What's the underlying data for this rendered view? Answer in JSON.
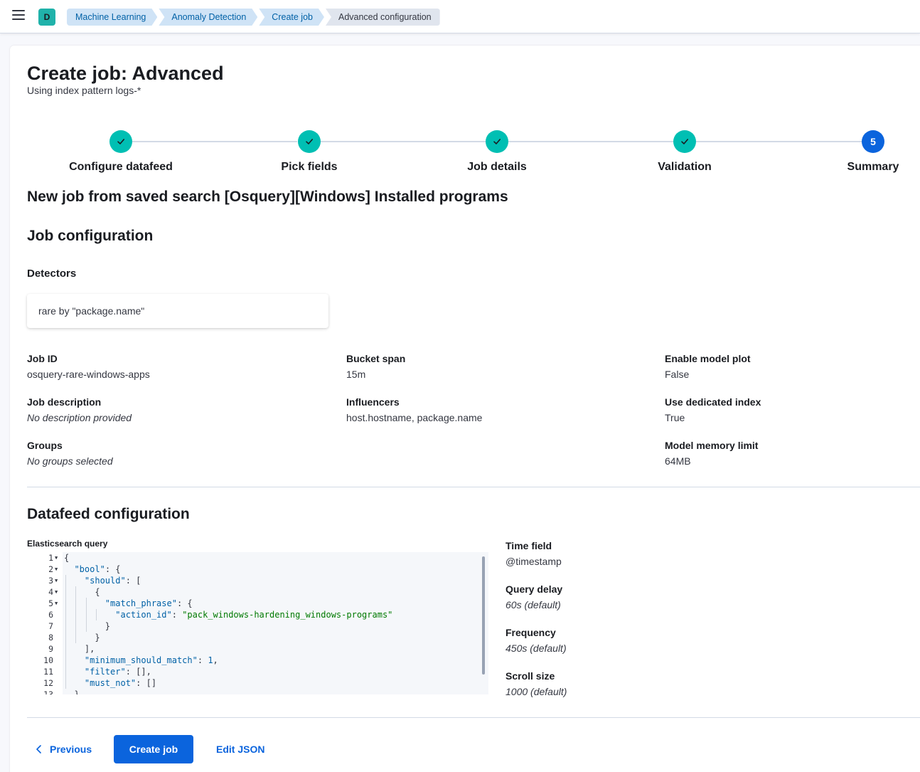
{
  "header": {
    "space_initial": "D",
    "breadcrumbs": [
      "Machine Learning",
      "Anomaly Detection",
      "Create job",
      "Advanced configuration"
    ]
  },
  "page": {
    "title": "Create job: Advanced",
    "subtitle": "Using index pattern logs-*"
  },
  "steps": [
    {
      "label": "Configure datafeed",
      "status": "complete"
    },
    {
      "label": "Pick fields",
      "status": "complete"
    },
    {
      "label": "Job details",
      "status": "complete"
    },
    {
      "label": "Validation",
      "status": "complete"
    },
    {
      "label": "Summary",
      "status": "current",
      "number": "5"
    }
  ],
  "summary": {
    "saved_search_heading": "New job from saved search [Osquery][Windows] Installed programs",
    "job_config_heading": "Job configuration",
    "detectors_heading": "Detectors",
    "detector": "rare by \"package.name\"",
    "job_id": {
      "label": "Job ID",
      "value": "osquery-rare-windows-apps"
    },
    "job_description": {
      "label": "Job description",
      "value": "No description provided"
    },
    "groups": {
      "label": "Groups",
      "value": "No groups selected"
    },
    "bucket_span": {
      "label": "Bucket span",
      "value": "15m"
    },
    "influencers": {
      "label": "Influencers",
      "value": "host.hostname, package.name"
    },
    "model_plot": {
      "label": "Enable model plot",
      "value": "False"
    },
    "dedicated_index": {
      "label": "Use dedicated index",
      "value": "True"
    },
    "memory_limit": {
      "label": "Model memory limit",
      "value": "64MB"
    }
  },
  "datafeed": {
    "heading": "Datafeed configuration",
    "query_label": "Elasticsearch query",
    "time_field": {
      "label": "Time field",
      "value": "@timestamp"
    },
    "query_delay": {
      "label": "Query delay",
      "value": "60s (default)"
    },
    "frequency": {
      "label": "Frequency",
      "value": "450s (default)"
    },
    "scroll_size": {
      "label": "Scroll size",
      "value": "1000 (default)"
    },
    "code_lines": [
      "{",
      "  \"bool\": {",
      "    \"should\": [",
      "      {",
      "        \"match_phrase\": {",
      "          \"action_id\": \"pack_windows-hardening_windows-programs\"",
      "        }",
      "      }",
      "    ],",
      "    \"minimum_should_match\": 1,",
      "    \"filter\": [],",
      "    \"must_not\": []",
      "  }"
    ]
  },
  "footer": {
    "previous_label": "Previous",
    "create_label": "Create job",
    "edit_json_label": "Edit JSON"
  }
}
